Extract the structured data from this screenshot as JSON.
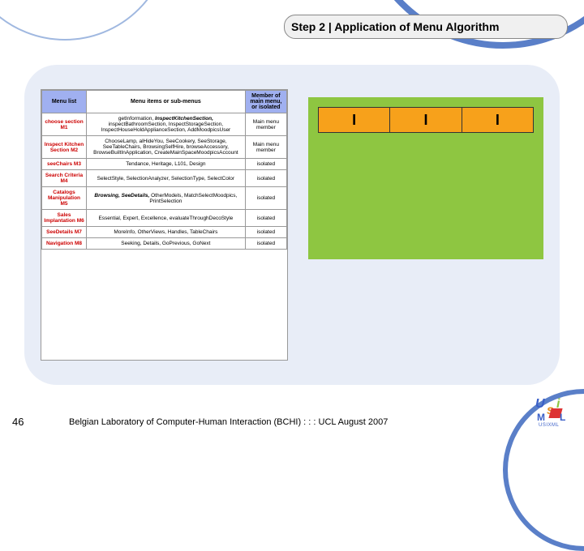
{
  "title": "Step 2 | Application of Menu Algorithm",
  "table": {
    "headers": {
      "c1": "Menu list",
      "c2": "Menu items or sub-menus",
      "c3": "Member of main menu, or isolated"
    },
    "rows": [
      {
        "head": "choose section M1",
        "items_prefix": "getInformation,",
        "items_bold": "InspectKitchenSection,",
        "items_rest": "inspectBathroomSection, InspectStorageSection, InspectHouseHoldApplianceSection, AddMoodpicsUser",
        "member": "Main menu member"
      },
      {
        "head": "Inspect Kitchen Section M2",
        "items": "ChooseLamp, alHideYou, SeeCookery, SeeStorage, SeeTableChairs, BrowsingSelfHire, browseAccessory, BrowseBuiltInApplication, CreateMainSpaceMoodpicsAccount",
        "member": "Main menu member"
      },
      {
        "head": "seeChairs M3",
        "items": "Tendance, Heritage, L101, Design",
        "member": "isolated"
      },
      {
        "head": "Search Criteria M4",
        "items": "SelectStyle, SelectionAnalyzer, SelectionType, SelectColor",
        "member": "isolated"
      },
      {
        "head": "Catalogs Manipulation M5",
        "items_bold": "Browsing, SeeDetails,",
        "items_rest": "OtherModels, MatchSelectMoodpics, PrintSelection",
        "member": "isolated"
      },
      {
        "head": "Sales Implantation M6",
        "items": "Essential, Expert, Excellence, evaluateThroughDecoStyle",
        "member": "isolated"
      },
      {
        "head": "SeeDetails M7",
        "items": "MoreInfo, OtherViews, Handles, TableChairs",
        "member": "isolated"
      },
      {
        "head": "Navigation M8",
        "items": "Seeking, Details, GoPrevious, GoNext",
        "member": "isolated"
      }
    ]
  },
  "orange_cells": [
    "I",
    "I",
    "I"
  ],
  "footer": {
    "page": "46",
    "text": "Belgian Laboratory of Computer-Human Interaction (BCHI) : : : UCL  August 2007"
  },
  "logo": {
    "tag": "USIXML"
  }
}
